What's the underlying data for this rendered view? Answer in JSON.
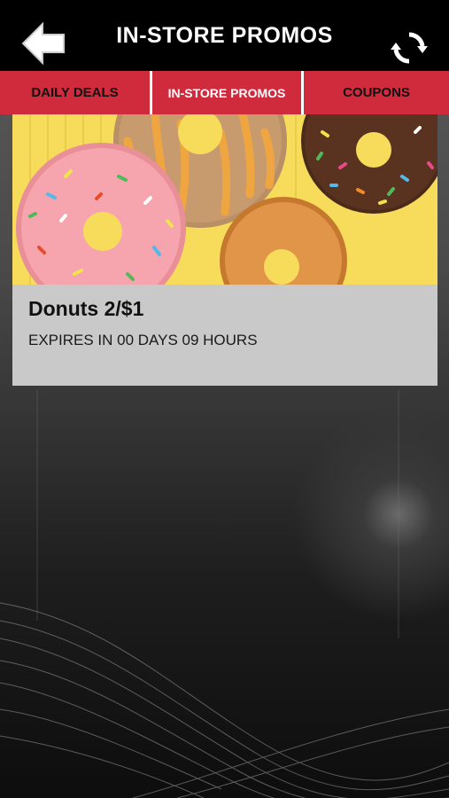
{
  "header": {
    "title": "IN-STORE PROMOS",
    "back_icon": "back-arrow-icon",
    "refresh_icon": "refresh-icon"
  },
  "tabs": [
    {
      "label": "DAILY DEALS",
      "active": false
    },
    {
      "label": "IN-STORE PROMOS",
      "active": true
    },
    {
      "label": "COUPONS",
      "active": false
    }
  ],
  "promo": {
    "title": "Donuts 2/$1",
    "expiry": "EXPIRES IN 00 DAYS 09 HOURS"
  },
  "colors": {
    "tab_bar": "#d02a3d",
    "header": "#000000",
    "card": "#c9c9c9"
  }
}
